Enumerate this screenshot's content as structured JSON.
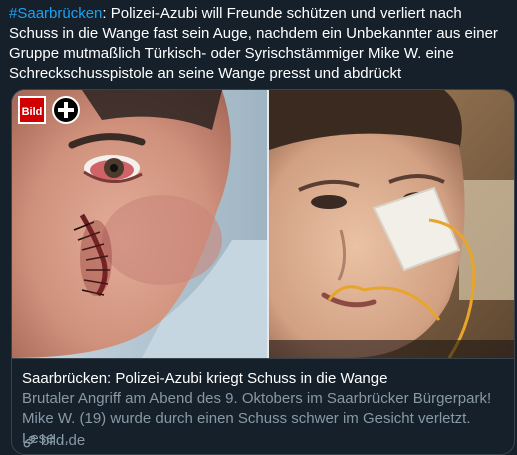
{
  "tweet": {
    "hashtag": "#Saarbrücken",
    "text": ": Polizei-Azubi will Freunde schützen und verliert nach Schuss in die Wange fast sein Auge, nachdem ein Unbekannter aus einer Gruppe mutmaßlich Türkisch- oder Syrischstämmiger Mike W. eine Schreckschusspistole an seine Wange presst und abdrückt"
  },
  "card": {
    "logo_text": "Bild",
    "title": "Saarbrücken: Polizei-Azubi kriegt Schuss in die Wange",
    "description": "Brutaler Angriff am Abend des 9. Oktobers im Saarbrücker Bürgerpark! Mike W. (19) wurde durch einen Schuss schwer im Gesicht verletzt. Lese…",
    "domain": "bild.de",
    "link_icon": "link-icon",
    "logo_icon": "bild-plus-logo"
  },
  "colors": {
    "background": "#15202b",
    "hashtag": "#1da1f2",
    "muted_text": "#8899a6",
    "border": "#38444d",
    "bild_red": "#d00000"
  }
}
